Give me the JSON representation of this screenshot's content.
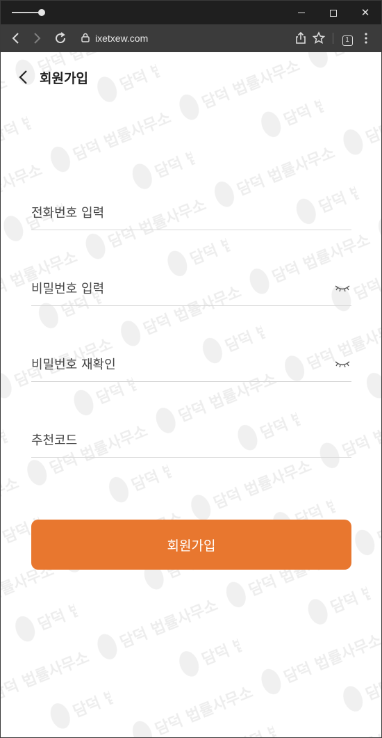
{
  "browser": {
    "url": "ixetxew.com",
    "tab_count": "1",
    "icons": [
      "back-arrow-icon",
      "forward-arrow-icon",
      "reload-icon",
      "lock-icon",
      "share-icon",
      "star-icon",
      "menu-dots-icon"
    ]
  },
  "window_controls": {
    "minimize": "minimize-icon",
    "maximize": "maximize-icon",
    "close": "close-icon"
  },
  "header": {
    "title": "회원가입"
  },
  "form": {
    "phone_placeholder": "전화번호 입력",
    "password_placeholder": "비밀번호 입력",
    "password_confirm_placeholder": "비밀번호 재확인",
    "referral_placeholder": "추천코드",
    "submit_label": "회원가입"
  },
  "watermark": {
    "text": "담덕 법률사무소"
  },
  "colors": {
    "accent": "#e8772f",
    "titlebar": "#1f1f1f",
    "toolbar": "#3b3b3b"
  }
}
